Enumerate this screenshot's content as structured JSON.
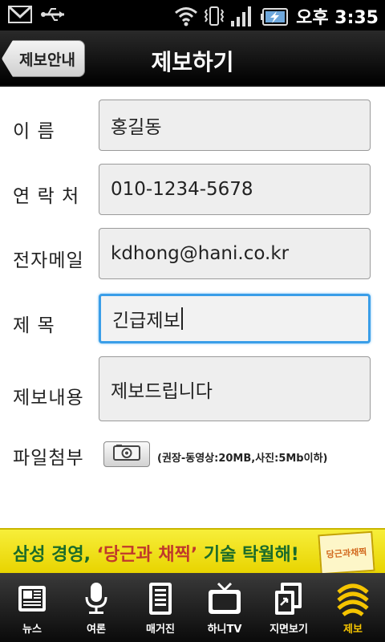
{
  "status_bar": {
    "time": "오후 3:35",
    "icons": [
      "gmail-icon",
      "usb-icon",
      "wifi-icon",
      "vibrate-icon",
      "signal-icon",
      "battery-charging-icon"
    ]
  },
  "header": {
    "back_label": "제보안내",
    "title": "제보하기"
  },
  "form": {
    "name_label": "이    름",
    "name_value": "홍길동",
    "contact_label": "연 락 처",
    "contact_value": "010-1234-5678",
    "email_label": "전자메일",
    "email_value": "kdhong@hani.co.kr",
    "subject_label": "제    목",
    "subject_value": "긴급제보",
    "content_label": "제보내용",
    "content_value": "제보드립니다",
    "attach_label": "파일첨부",
    "attach_note": "(권장-동영상:20MB,사진:5Mb이하)"
  },
  "banner": {
    "text_part1": "삼성 경영, ",
    "text_quote": "‘당근과 채찍’",
    "text_part2": " 기술 탁월해!",
    "book_title": "당근과채찍"
  },
  "tabs": [
    {
      "label": "뉴스",
      "icon": "newspaper-icon"
    },
    {
      "label": "여론",
      "icon": "microphone-icon"
    },
    {
      "label": "매거진",
      "icon": "magazine-icon"
    },
    {
      "label": "하니TV",
      "icon": "tv-icon"
    },
    {
      "label": "지면보기",
      "icon": "page-view-icon"
    },
    {
      "label": "제보",
      "icon": "report-icon"
    }
  ],
  "active_tab": "제보",
  "colors": {
    "focus_border": "#3a9ee8",
    "active_tab": "#f5c400",
    "banner_bg": "#f7ee3a"
  }
}
